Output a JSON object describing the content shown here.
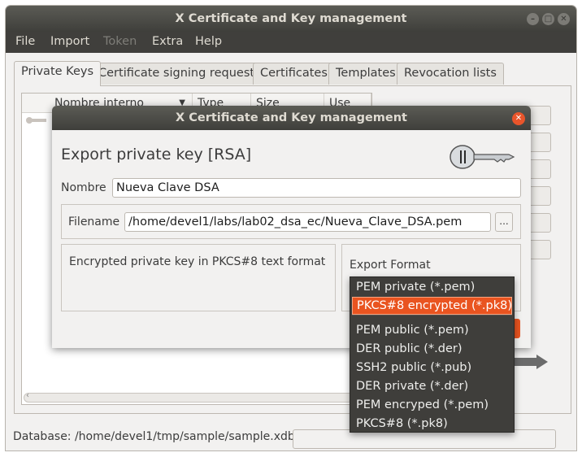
{
  "window": {
    "title": "X Certificate and Key management",
    "menu": [
      "File",
      "Import",
      "Token",
      "Extra",
      "Help"
    ],
    "menu_disabled": "Token",
    "tabs": [
      "Private Keys",
      "Certificate signing requests",
      "Certificates",
      "Templates",
      "Revocation lists"
    ],
    "active_tab": "Private Keys",
    "columns": [
      "Nombre interno",
      "Type",
      "Size",
      "Use"
    ],
    "status_text": "Database: /home/devel1/tmp/sample/sample.xdb"
  },
  "dialog": {
    "title": "X Certificate and Key management",
    "heading": "Export private key [RSA]",
    "name_label": "Nombre",
    "name_value": "Nueva Clave DSA",
    "filename_label": "Filename",
    "filename_value": "/home/devel1/labs/lab02_dsa_ec/Nueva_Clave_DSA.pem",
    "browse_label": "...",
    "description": "Encrypted private key in PKCS#8 text format",
    "format_label": "Export Format"
  },
  "format_dropdown": {
    "selected": "PKCS#8 encrypted (*.pk8)",
    "options": [
      "PEM private (*.pem)",
      "PKCS#8 encrypted (*.pk8)",
      "PEM public (*.pem)",
      "DER public (*.der)",
      "SSH2 public (*.pub)",
      "DER private (*.der)",
      "PEM encryped (*.pem)",
      "PKCS#8 (*.pk8)"
    ]
  },
  "colors": {
    "accent": "#e95420",
    "titlebar": "#403f3c",
    "window_bg": "#f2f1f0"
  }
}
